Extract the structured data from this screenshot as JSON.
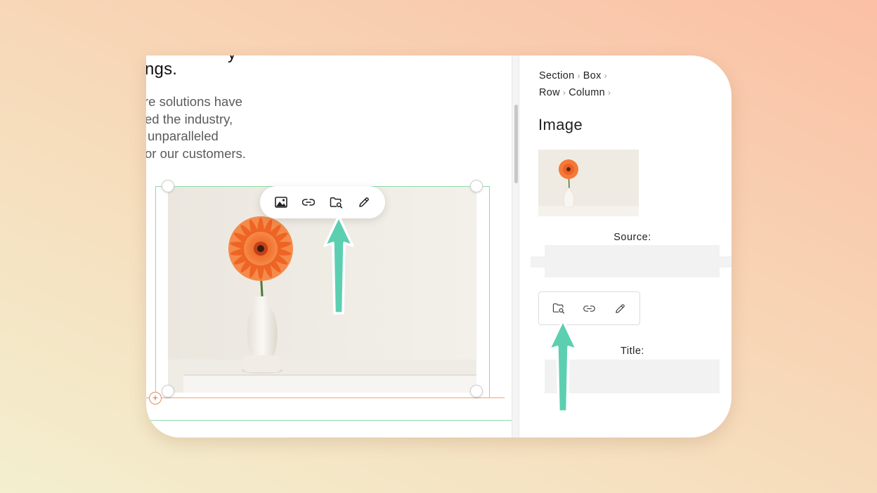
{
  "canvas": {
    "heading_prev": "y",
    "heading": "ngs.",
    "body_lines": [
      "re solutions have",
      "ed the industry,",
      "unparalleled",
      "or our customers."
    ],
    "add_symbol": "+",
    "toolbar": {
      "icons": [
        "image-icon",
        "link-icon",
        "folder-search-icon",
        "pencil-icon"
      ]
    }
  },
  "inspector": {
    "breadcrumb_row1": [
      "Section",
      "Box"
    ],
    "breadcrumb_row2": [
      "Row",
      "Column"
    ],
    "breadcrumb_separator": "›",
    "title": "Image",
    "source_label": "Source:",
    "title_label": "Title:",
    "actions": [
      "folder-search-icon",
      "link-icon",
      "pencil-icon"
    ]
  },
  "colors": {
    "selection_outline": "#8fd9a8",
    "insertion_line": "#f2a37a",
    "arrow": "#5ccfb1",
    "flower": "#f36a2a"
  }
}
